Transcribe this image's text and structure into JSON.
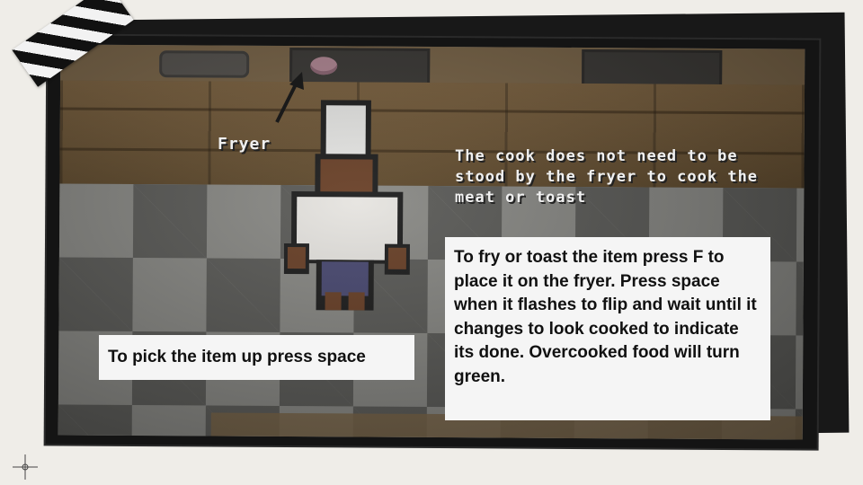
{
  "scene": {
    "fryer_label": "Fryer",
    "cook_note": "The cook does not need to be stood by the fryer to cook the meat or toast"
  },
  "instructions": {
    "pickup": "To pick the item up press space",
    "fry": "To fry or toast the item press F to place it on the fryer. Press space when it flashes to flip and wait until it changes to look cooked to indicate its done. Overcooked food will turn green."
  },
  "colors": {
    "frame": "#141414",
    "callout_bg": "#f5f5f5",
    "label_text": "#f0f0f0"
  },
  "icons": {
    "arrow": "arrow-up-left-icon",
    "crosshair": "crosshair-icon",
    "tape": "striped-tape"
  }
}
